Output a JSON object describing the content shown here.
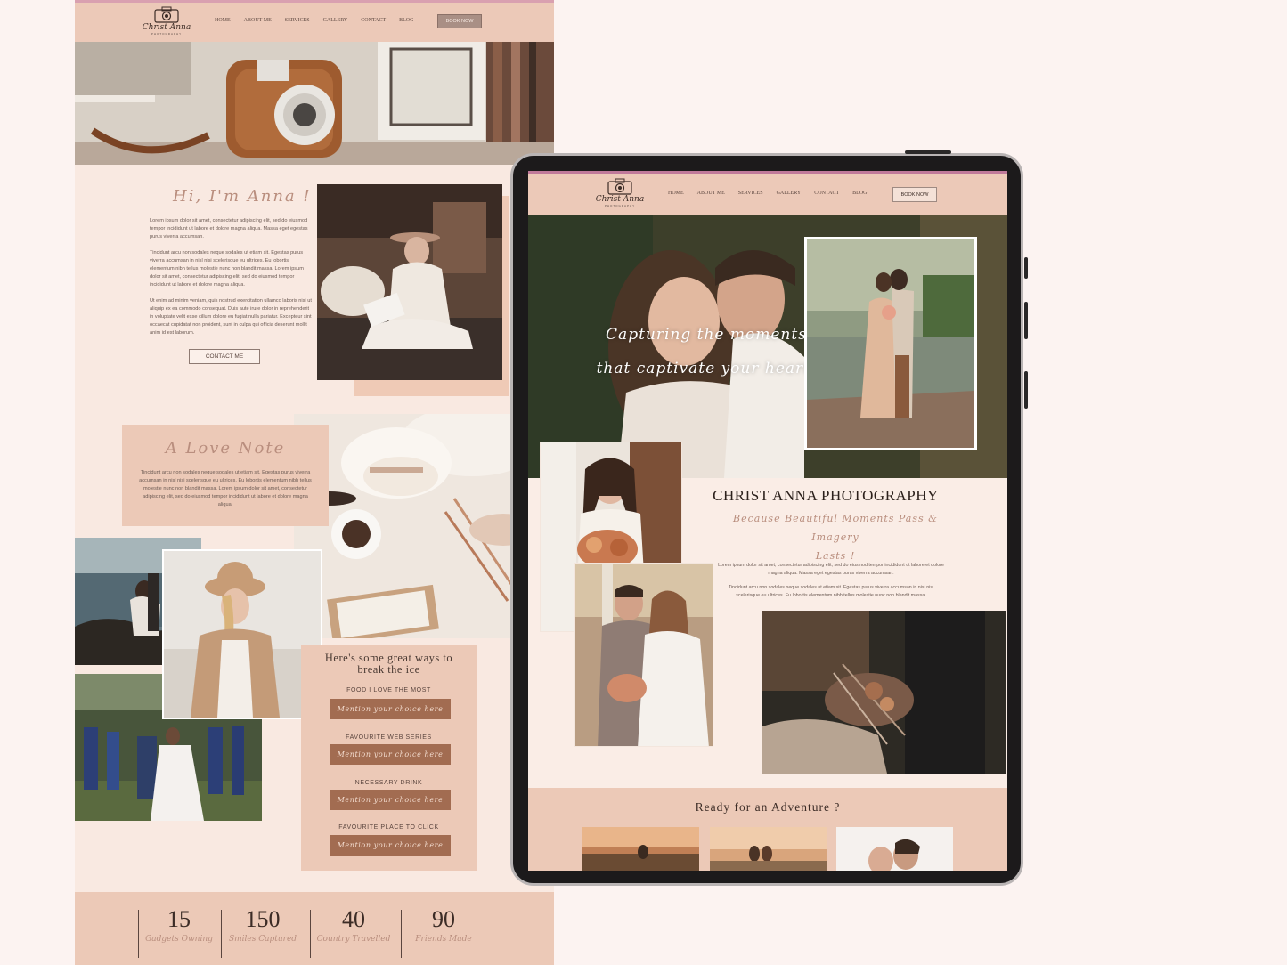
{
  "site": {
    "logo_script": "Christ Anna",
    "logo_sub": "PHOTOGRAPHY",
    "nav": [
      "HOME",
      "ABOUT ME",
      "SERVICES",
      "GALLERY",
      "CONTACT",
      "BLOG"
    ],
    "book_now": "BOOK NOW"
  },
  "about": {
    "title": "Hi, I'm Anna !",
    "p1": "Lorem ipsum dolor sit amet, consectetur adipiscing elit, sed do eiusmod tempor incididunt ut labore et dolore magna aliqua. Massa eget egestas purus viverra accumsan.",
    "p2": "Tincidunt arcu non sodales neque sodales ut etiam sit. Egestas purus viverra accumsan in nisl nisi scelerisque eu ultrices. Eu lobortis elementum nibh tellus molestie nunc non blandit massa. Lorem ipsum dolor sit amet, consectetur adipiscing elit, sed do eiusmod tempor incididunt ut labore et dolore magna aliqua.",
    "p3": "Ut enim ad minim veniam, quis nostrud exercitation ullamco laboris nisi ut aliquip ex ea commodo consequat. Duis aute irure dolor in reprehenderit in voluptate velit esse cillum dolore eu fugiat nulla pariatur. Excepteur sint occaecat cupidatat non proident, sunt in culpa qui officia deserunt mollit anim id est laborum.",
    "contact_button": "CONTACT ME"
  },
  "love_note": {
    "title": "A Love Note",
    "text": "Tincidunt arcu non sodales neque sodales ut etiam sit. Egestas purus viverra accumsan in nisl nisi scelerisque eu ultrices. Eu lobortis elementum nibh tellus molestie nunc non blandit massa. Lorem ipsum dolor sit amet, consectetur adipiscing elit, sed do eiusmod tempor incididunt ut labore et dolore magna aliqua."
  },
  "icebreaker": {
    "title_line1": "Here's some great ways to",
    "title_line2": "break the ice",
    "items": [
      {
        "label": "FOOD I LOVE THE MOST",
        "value": "Mention your choice here"
      },
      {
        "label": "FAVOURITE WEB SERIES",
        "value": "Mention your choice here"
      },
      {
        "label": "NECESSARY DRINK",
        "value": "Mention your choice here"
      },
      {
        "label": "FAVOURITE PLACE TO CLICK",
        "value": "Mention your choice here"
      }
    ]
  },
  "stats": [
    {
      "num": "15",
      "cap": "Gadgets Owning"
    },
    {
      "num": "150",
      "cap": "Smiles Captured"
    },
    {
      "num": "40",
      "cap": "Country Travelled"
    },
    {
      "num": "90",
      "cap": "Friends Made"
    }
  ],
  "tablet": {
    "hero_line1": "Capturing the moments",
    "hero_line2": "that captivate your heart.",
    "title": "CHRIST ANNA PHOTOGRAPHY",
    "subtitle_line1": "Because Beautiful Moments Pass & Imagery",
    "subtitle_line2": "Lasts !",
    "p1": "Lorem ipsum dolor sit amet, consectetur adipiscing elit, sed do eiusmod tempor incididunt ut labore et dolore magna aliqua. Massa eget egestas purus viverra accumsan.",
    "p2": "Tincidunt arcu non sodales neque sodales ut etiam sit. Egestas purus viverra accumsan in nisl nisi scelerisque eu ultrices. Eu lobortis elementum nibh tellus molestie nunc non blandit massa.",
    "adventure": "Ready for an Adventure ?"
  },
  "colors": {
    "page_bg": "#fcf3f1",
    "nav_bg": "#ecc9b8",
    "accent_pill": "#a26c51",
    "script_text": "#b98e7e",
    "book_button": "#a98f85"
  }
}
